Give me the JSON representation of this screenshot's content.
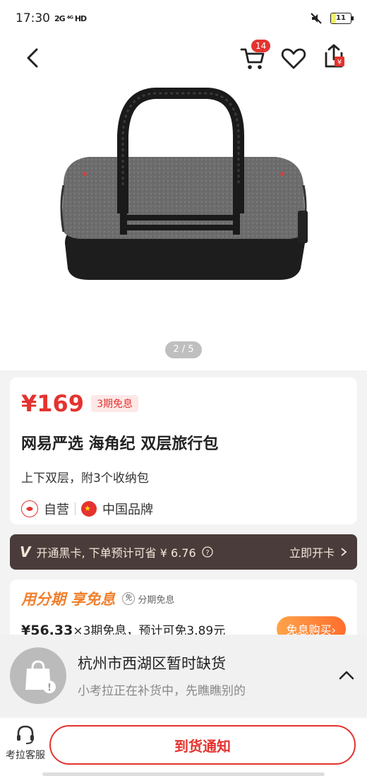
{
  "status_bar": {
    "time": "17:30",
    "network": "2G ⁴ᴳ HD",
    "battery": "11"
  },
  "nav": {
    "cart_count": "14"
  },
  "gallery": {
    "page_indicator": "2 / 5"
  },
  "product": {
    "price": "¥169",
    "installment_tag": "3期免息",
    "title": "网易严选 海角纪 双层旅行包",
    "subtitle": "上下双层，附3个收纳包",
    "self_operated": "自营",
    "brand_origin": "中国品牌"
  },
  "member": {
    "text": "开通黑卡, 下单预计可省 ¥ 6.76",
    "action": "立即开卡"
  },
  "finance": {
    "title": "用分期  享免息",
    "tag": "分期免息",
    "tag_icon": "免",
    "amount": "¥56.33",
    "detail": "×3期免息，预计可免3.89元",
    "button": "免息购买"
  },
  "stock": {
    "title": "杭州市西湖区暂时缺货",
    "subtitle": "小考拉正在补货中，先瞧瞧别的"
  },
  "bottom": {
    "service_label": "考拉客服",
    "notify_label": "到货通知"
  },
  "colors": {
    "accent_red": "#e4332f",
    "member_bg": "#4a3c3a",
    "finance_orange": "#f0802e"
  }
}
